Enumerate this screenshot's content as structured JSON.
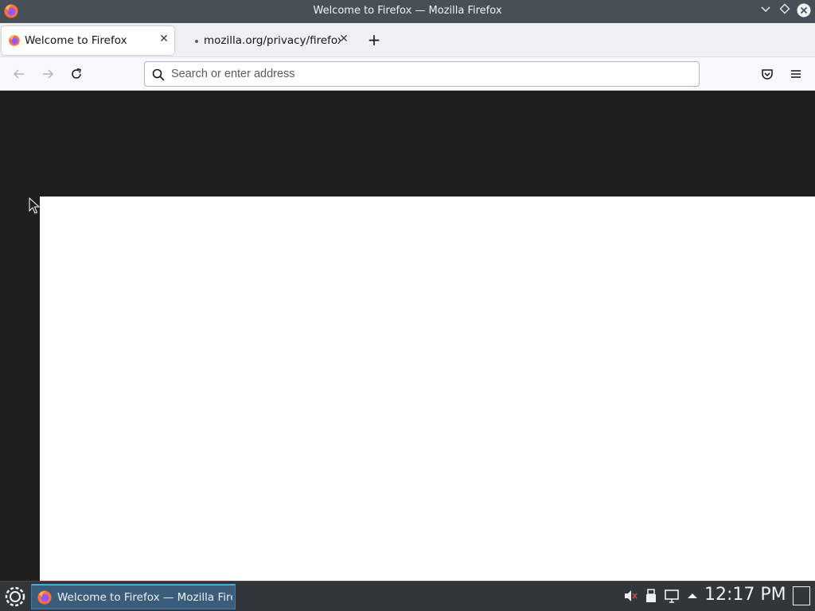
{
  "window": {
    "title": "Welcome to Firefox — Mozilla Firefox",
    "app_icon": "firefox-icon",
    "buttons": [
      "minimize-icon",
      "maximize-icon",
      "close-icon"
    ]
  },
  "tabs": [
    {
      "label": "Welcome to Firefox",
      "active": true,
      "icon": "firefox-icon"
    },
    {
      "label": "mozilla.org/privacy/firefox/",
      "active": false,
      "icon": "dot-icon"
    }
  ],
  "navbar": {
    "search_placeholder": "Search or enter address"
  },
  "taskbar": {
    "task_label": "Welcome to Firefox — Mozilla Firef...",
    "clock": "12:17 PM"
  },
  "colors": {
    "titlebar": "#475057",
    "tabbar": "#f0f0f4",
    "taskbar": "#31363b",
    "content_dark": "#1f1f1f"
  }
}
